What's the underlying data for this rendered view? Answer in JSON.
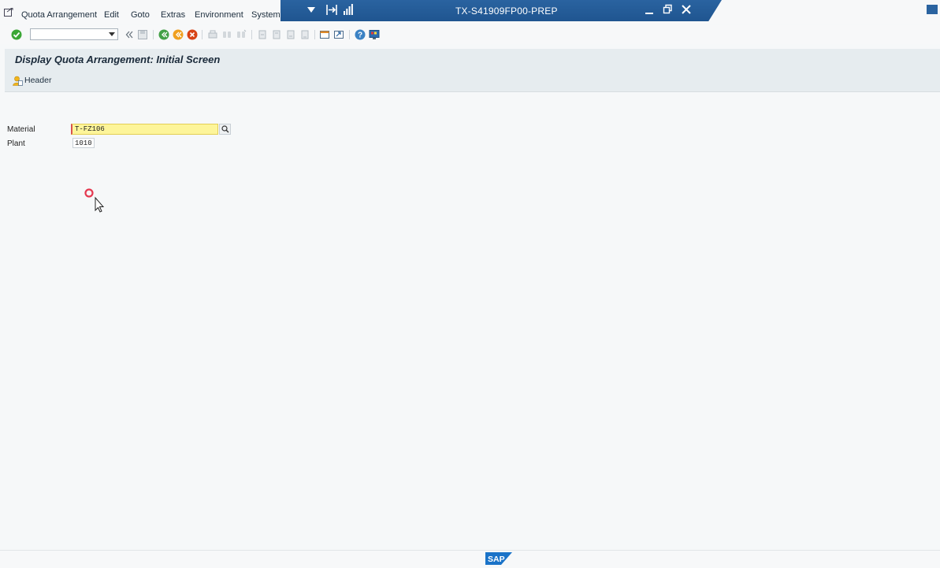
{
  "menubar": {
    "items": [
      "Quota Arrangement",
      "Edit",
      "Goto",
      "Extras",
      "Environment",
      "System"
    ]
  },
  "window": {
    "title": "TX-S41909FP00-PREP"
  },
  "screen": {
    "title": "Display Quota Arrangement: Initial Screen",
    "header_button": "Header"
  },
  "form": {
    "material_label": "Material",
    "material_value": "T-FZ106",
    "plant_label": "Plant",
    "plant_value": "1010"
  },
  "footer": {
    "logo_text": "SAP"
  },
  "colors": {
    "title_bar": "#2a63a0",
    "required_field": "#fdf59a",
    "sap_logo": "#1a73c8"
  }
}
